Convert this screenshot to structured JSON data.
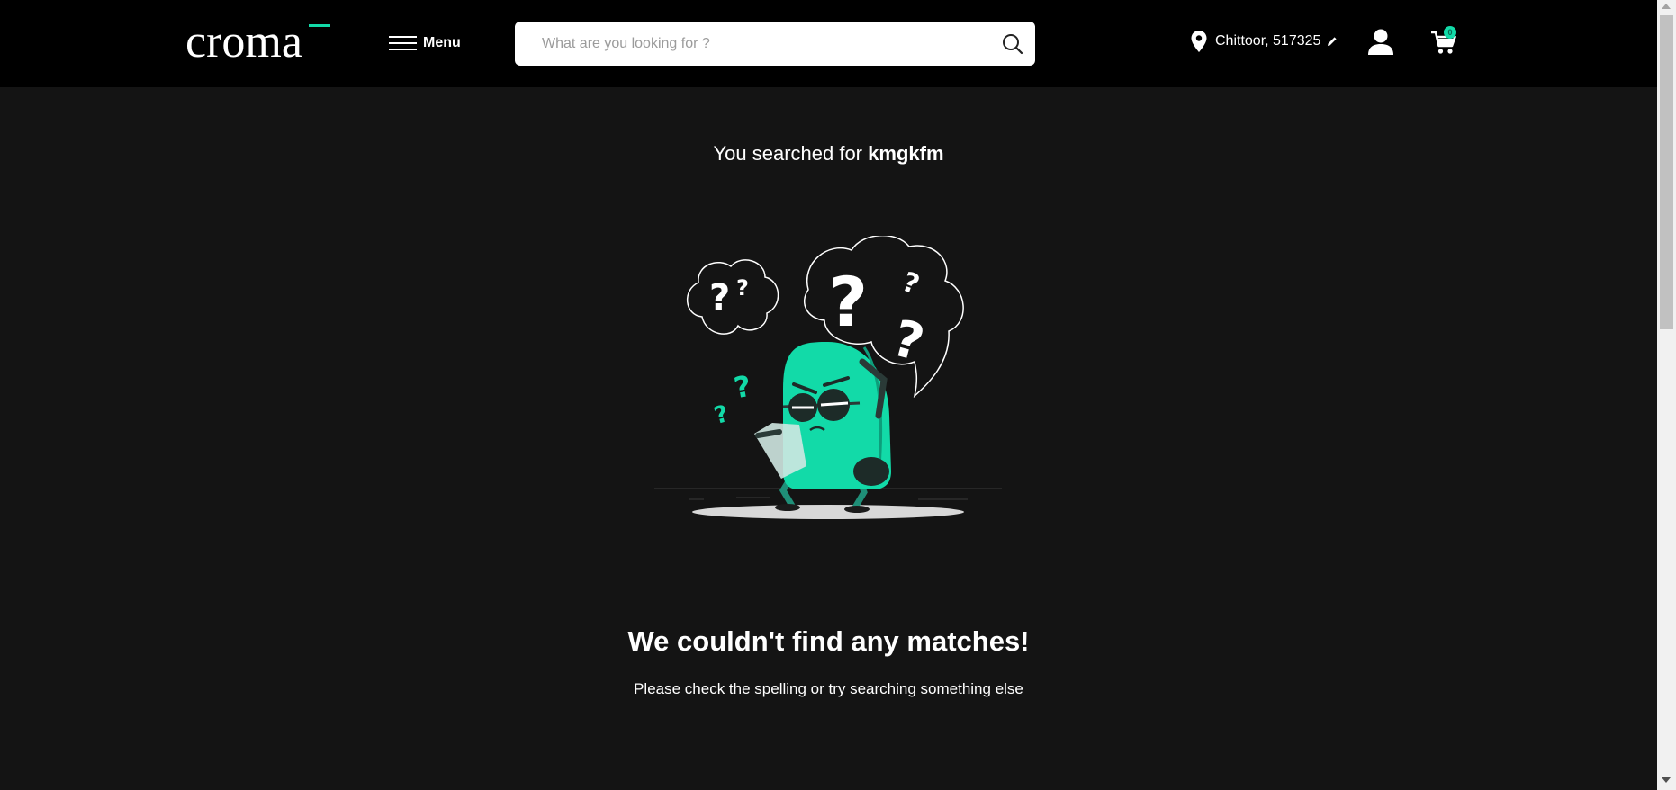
{
  "header": {
    "logo_text": "croma",
    "menu_label": "Menu",
    "search_placeholder": "What are you looking for ?",
    "search_value": "",
    "location": "Chittoor, 517325",
    "cart_count": "0"
  },
  "results": {
    "searched_prefix": "You searched for",
    "query": "kmgkfm",
    "no_match_title": "We couldn't find any matches!",
    "no_match_hint": "Please check the spelling or try searching something else"
  },
  "icons": {
    "menu": "hamburger-icon",
    "search": "search-icon",
    "location": "map-pin-icon",
    "edit": "pencil-icon",
    "user": "user-icon",
    "cart": "cart-icon",
    "illustration": "confused-character-illustration"
  },
  "colors": {
    "header_bg": "#000000",
    "page_bg": "#141414",
    "accent": "#12daa8"
  }
}
